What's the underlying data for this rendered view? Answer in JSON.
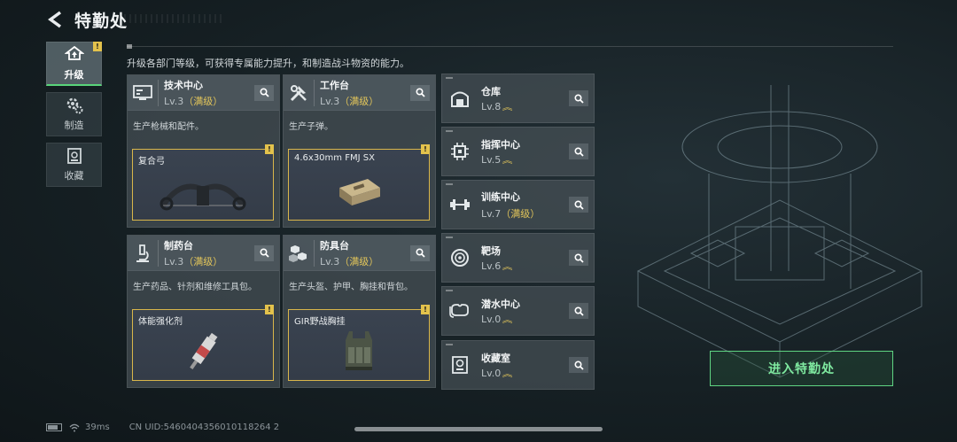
{
  "header": {
    "title": "特勤处"
  },
  "sidebar": {
    "tabs": [
      {
        "label": "升级",
        "active": true,
        "badge": "!"
      },
      {
        "label": "制造",
        "active": false
      },
      {
        "label": "收藏",
        "active": false
      }
    ]
  },
  "description": "升级各部门等级，可获得专属能力提升，和制造战斗物资的能力。",
  "cards": [
    {
      "name": "技术中心",
      "level": "Lv.3",
      "max": "（满级）",
      "desc": "生产枪械和配件。",
      "icon": "monitor-icon",
      "product": {
        "name": "复合弓",
        "badge": "!",
        "icon": "compound-bow-icon"
      }
    },
    {
      "name": "工作台",
      "level": "Lv.3",
      "max": "（满级）",
      "desc": "生产子弹。",
      "icon": "tools-icon",
      "product": {
        "name": "4.6x30mm FMJ SX",
        "badge": "!",
        "icon": "ammo-box-icon"
      }
    },
    {
      "name": "制药台",
      "level": "Lv.3",
      "max": "（满级）",
      "desc": "生产药品、针剂和维修工具包。",
      "icon": "microscope-icon",
      "product": {
        "name": "体能强化剂",
        "badge": "!",
        "icon": "syringe-icon"
      }
    },
    {
      "name": "防具台",
      "level": "Lv.3",
      "max": "（满级）",
      "desc": "生产头盔、护甲、胸挂和背包。",
      "icon": "armor-cubes-icon",
      "product": {
        "name": "GIR野战胸挂",
        "badge": "!",
        "icon": "chest-rig-icon"
      }
    }
  ],
  "facilities": [
    {
      "name": "仓库",
      "level": "Lv.8",
      "max": "",
      "upgradable": true,
      "icon": "warehouse-icon"
    },
    {
      "name": "指挥中心",
      "level": "Lv.5",
      "max": "",
      "upgradable": true,
      "icon": "chip-icon"
    },
    {
      "name": "训练中心",
      "level": "Lv.7",
      "max": "（满级）",
      "upgradable": false,
      "icon": "dumbbell-icon"
    },
    {
      "name": "靶场",
      "level": "Lv.6",
      "max": "",
      "upgradable": true,
      "icon": "target-icon"
    },
    {
      "name": "潜水中心",
      "level": "Lv.0",
      "max": "",
      "upgradable": true,
      "icon": "diving-mask-icon"
    },
    {
      "name": "收藏室",
      "level": "Lv.0",
      "max": "",
      "upgradable": true,
      "icon": "collection-icon"
    }
  ],
  "enter_button": "进入特勤处",
  "status": {
    "latency": "39ms",
    "uid": "CN UID:5460404356010118264 2"
  },
  "colors": {
    "accent_green": "#5fd482",
    "gold": "#e2c55a"
  }
}
